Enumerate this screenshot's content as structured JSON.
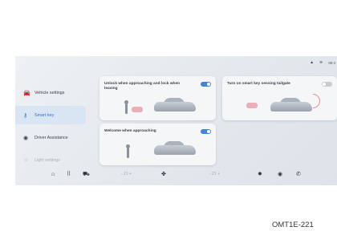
{
  "status_bar": {
    "icons": [
      "signal-icon",
      "wifi-icon"
    ],
    "time": "09:4"
  },
  "sidebar": {
    "items": [
      {
        "label": "Vehicle settings",
        "icon": "car-icon",
        "active": false
      },
      {
        "label": "Smart key",
        "icon": "key-icon",
        "active": true
      },
      {
        "label": "Driver Assistance",
        "icon": "steering-icon",
        "active": false
      },
      {
        "label": "Light settings",
        "icon": "light-icon",
        "active": false
      }
    ]
  },
  "cards": {
    "unlock": {
      "title": "Unlock when approaching and lock when leaving",
      "enabled": true
    },
    "tailgate": {
      "title": "Turn on smart key sensing tailgate",
      "enabled": false
    },
    "welcome": {
      "title": "Welcome when approaching",
      "enabled": true
    }
  },
  "dock": {
    "left_temp": "- 21 +",
    "right_temp": "- 21 +",
    "icons": [
      "home-icon",
      "apps-icon",
      "car-icon",
      "fan-icon",
      "settings-icon",
      "navigation-icon",
      "phone-icon"
    ]
  },
  "caption": "OMT1E-221"
}
